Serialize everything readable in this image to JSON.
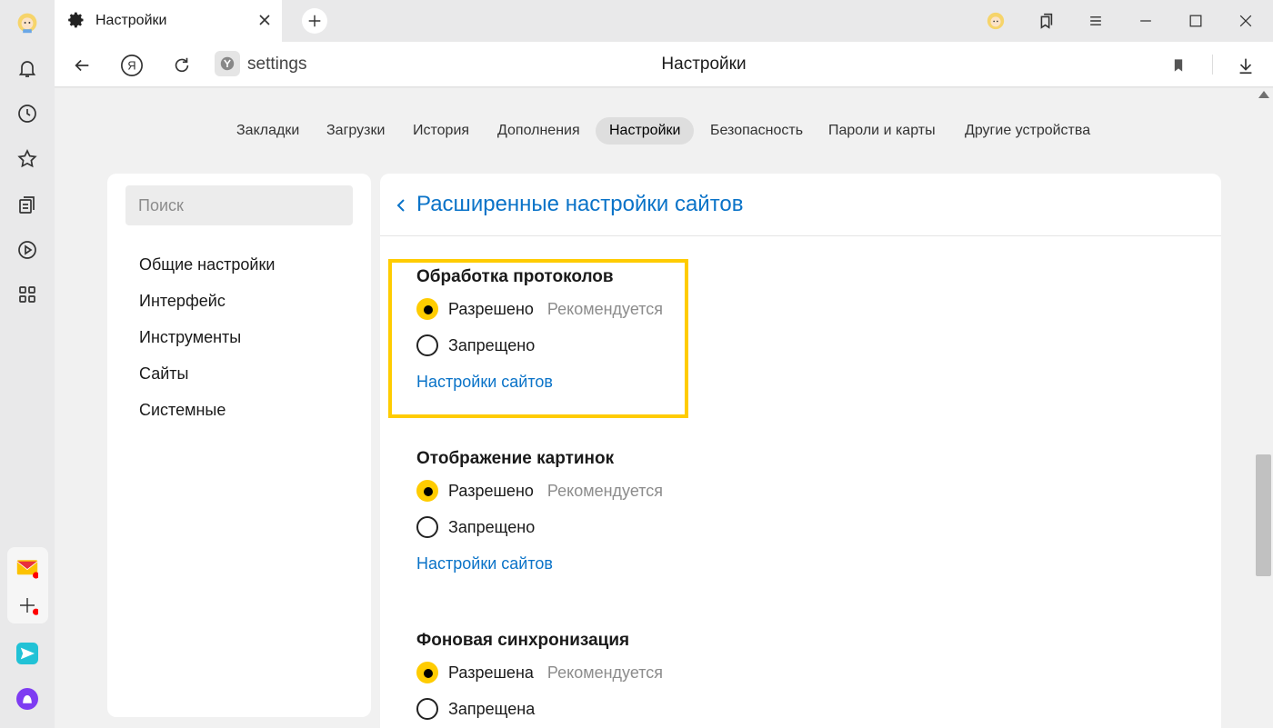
{
  "tab": {
    "title": "Настройки"
  },
  "address": {
    "url": "settings",
    "page_title": "Настройки"
  },
  "topnav": [
    {
      "label": "Закладки",
      "active": false
    },
    {
      "label": "Загрузки",
      "active": false
    },
    {
      "label": "История",
      "active": false
    },
    {
      "label": "Дополнения",
      "active": false
    },
    {
      "label": "Настройки",
      "active": true
    },
    {
      "label": "Безопасность",
      "active": false
    },
    {
      "label": "Пароли и карты",
      "active": false
    },
    {
      "label": "Другие устройства",
      "active": false
    }
  ],
  "search": {
    "placeholder": "Поиск"
  },
  "menu": [
    {
      "label": "Общие настройки"
    },
    {
      "label": "Интерфейс"
    },
    {
      "label": "Инструменты"
    },
    {
      "label": "Сайты"
    },
    {
      "label": "Системные"
    }
  ],
  "main": {
    "title": "Расширенные настройки сайтов",
    "sections": [
      {
        "title": "Обработка протоколов",
        "options": [
          {
            "label": "Разрешено",
            "hint": "Рекомендуется",
            "selected": true
          },
          {
            "label": "Запрещено",
            "hint": "",
            "selected": false
          }
        ],
        "link": "Настройки сайтов"
      },
      {
        "title": "Отображение картинок",
        "options": [
          {
            "label": "Разрешено",
            "hint": "Рекомендуется",
            "selected": true
          },
          {
            "label": "Запрещено",
            "hint": "",
            "selected": false
          }
        ],
        "link": "Настройки сайтов"
      },
      {
        "title": "Фоновая синхронизация",
        "options": [
          {
            "label": "Разрешена",
            "hint": "Рекомендуется",
            "selected": true
          },
          {
            "label": "Запрещена",
            "hint": "",
            "selected": false
          }
        ],
        "link": ""
      }
    ]
  },
  "colors": {
    "accent": "#ffcc00",
    "link": "#0a73c8",
    "highlight": "#ffcc00"
  },
  "icons": {
    "sidebar": [
      "avatar-icon",
      "bell-icon",
      "clock-icon",
      "star-icon",
      "collections-icon",
      "play-icon",
      "apps-grid-icon",
      "mail-icon",
      "plus-icon",
      "messenger-icon",
      "alice-icon"
    ]
  }
}
